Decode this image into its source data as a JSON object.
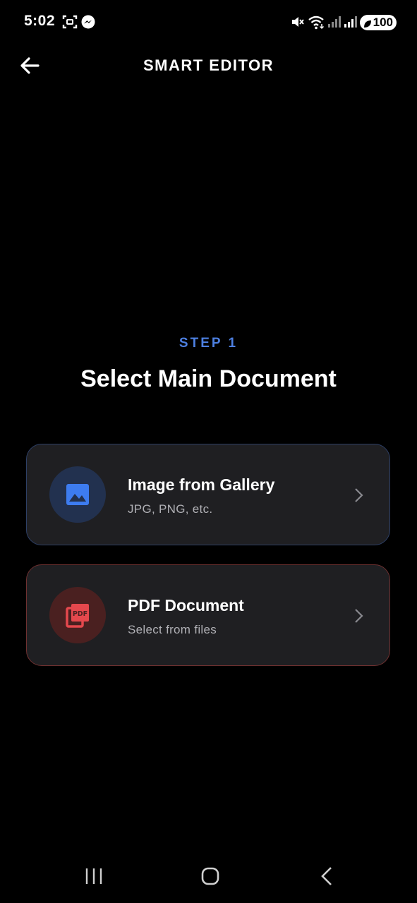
{
  "status_bar": {
    "time": "5:02",
    "battery": "100",
    "icons": [
      "screenshot-icon",
      "messenger-icon",
      "mute-icon",
      "wifi-icon",
      "signal-icon",
      "signal-icon",
      "battery-saver-icon"
    ]
  },
  "header": {
    "title": "SMART EDITOR",
    "back_icon": "arrow-left-icon"
  },
  "step": {
    "label": "STEP 1",
    "heading": "Select Main Document"
  },
  "options": [
    {
      "title": "Image from Gallery",
      "subtitle": "JPG, PNG, etc.",
      "icon": "image-icon",
      "accent": "#3d7cf0"
    },
    {
      "title": "PDF Document",
      "subtitle": "Select from files",
      "icon": "pdf-icon",
      "accent": "#e5484d"
    }
  ],
  "navigation": {
    "icons": [
      "recent-apps-icon",
      "home-icon",
      "back-icon"
    ]
  },
  "colors": {
    "background": "#000000",
    "step_accent": "#4d7fe0",
    "card_bg": "#1f1f22"
  }
}
